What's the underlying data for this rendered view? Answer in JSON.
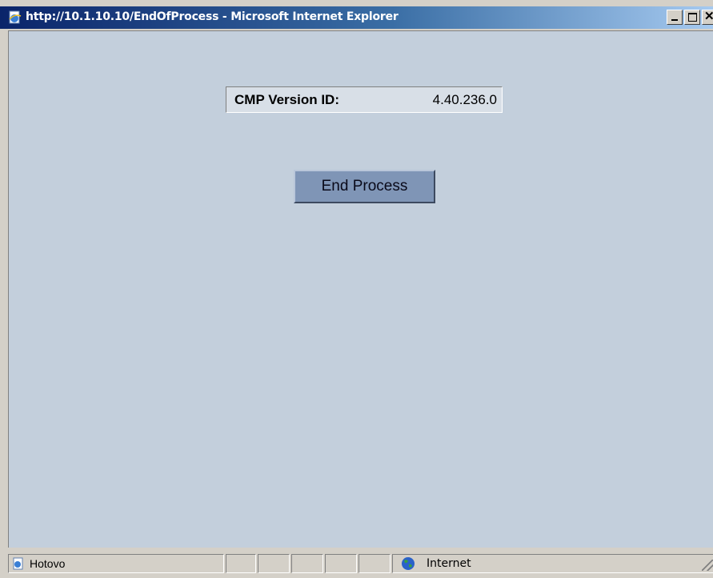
{
  "window": {
    "title": "http://10.1.10.10/EndOfProcess - Microsoft Internet Explorer",
    "title_bar_icon": "ie-page-icon",
    "buttons": [
      "minimize-button",
      "maximize-button",
      "close-button"
    ]
  },
  "page": {
    "version_label": "CMP Version ID:",
    "version_value": "4.40.236.0",
    "end_button_label": "End Process"
  },
  "statusbar": {
    "status_text": "Hotovo",
    "zone_text": "Internet",
    "empty_pane_count": 5
  },
  "colors": {
    "client_background": "#c3cfdc",
    "button_background": "#7f95b6",
    "title_bar": "#0a246a"
  }
}
